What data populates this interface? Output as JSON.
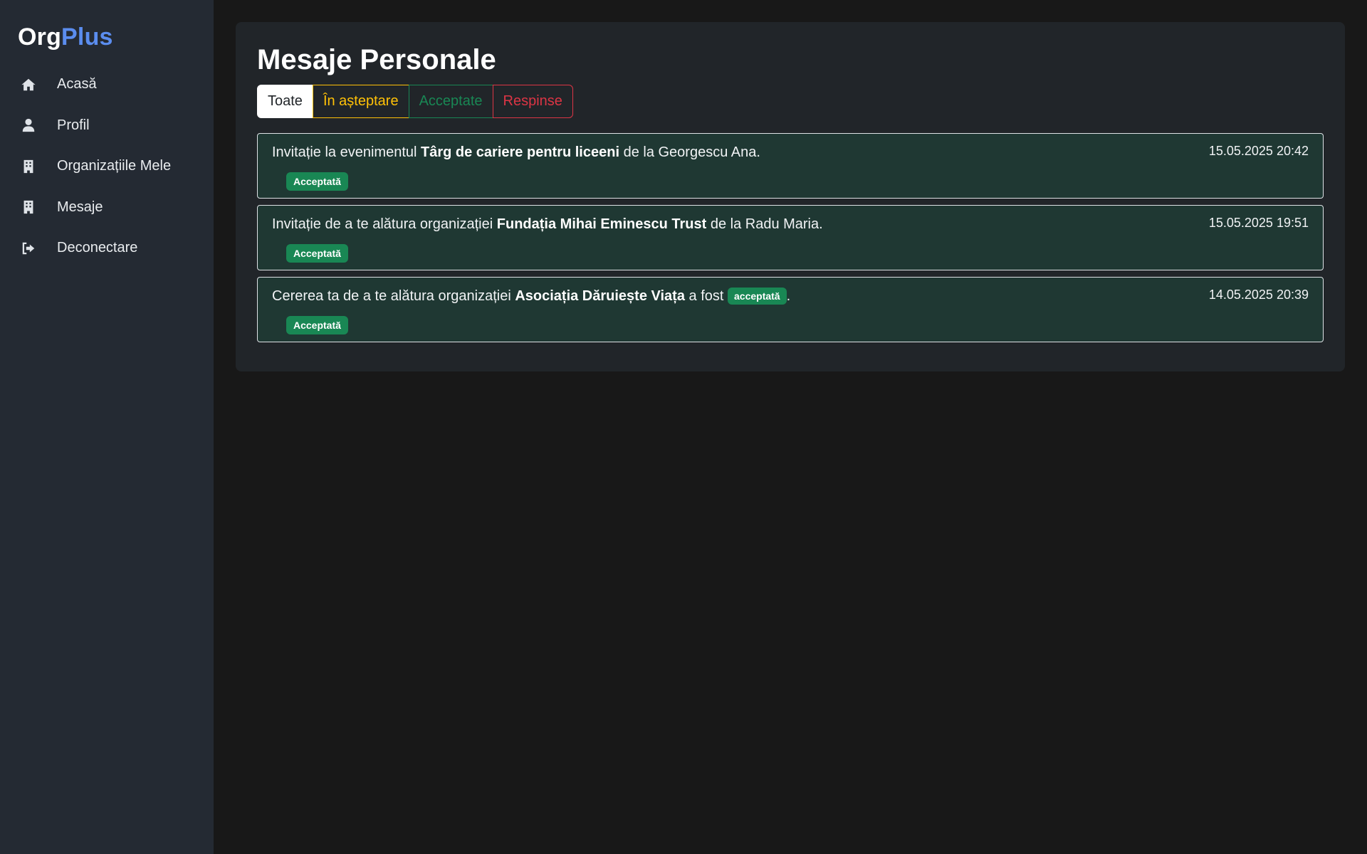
{
  "brand": {
    "part1": "Org",
    "part2": "Plus"
  },
  "sidebar": {
    "items": [
      {
        "label": "Acasă",
        "icon": "home-icon"
      },
      {
        "label": "Profil",
        "icon": "user-icon"
      },
      {
        "label": "Organizațiile Mele",
        "icon": "building-icon"
      },
      {
        "label": "Mesaje",
        "icon": "building-icon"
      },
      {
        "label": "Deconectare",
        "icon": "logout-icon"
      }
    ]
  },
  "main": {
    "title": "Mesaje Personale",
    "filters": {
      "all": "Toate",
      "pending": "În așteptare",
      "accepted": "Acceptate",
      "rejected": "Respinse"
    },
    "messages": [
      {
        "prefix": "Invitație la evenimentul ",
        "bold": "Târg de cariere pentru liceeni",
        "suffix": " de la Georgescu Ana.",
        "date": "15.05.2025 20:42",
        "status": "Acceptată"
      },
      {
        "prefix": "Invitație de a te alătura organizației ",
        "bold": "Fundația Mihai Eminescu Trust",
        "suffix": " de la Radu Maria.",
        "date": "15.05.2025 19:51",
        "status": "Acceptată"
      },
      {
        "prefix": "Cererea ta de a te alătura organizației ",
        "bold": "Asociația Dăruiește Viața",
        "middle": " a fost ",
        "inline_badge": "acceptată",
        "suffix": ".",
        "date": "14.05.2025 20:39",
        "status": "Acceptată"
      }
    ]
  },
  "colors": {
    "accent": "#5b8def",
    "success": "#198754",
    "warning": "#ffc107",
    "danger": "#dc3545",
    "message_bg": "#1f3833"
  }
}
